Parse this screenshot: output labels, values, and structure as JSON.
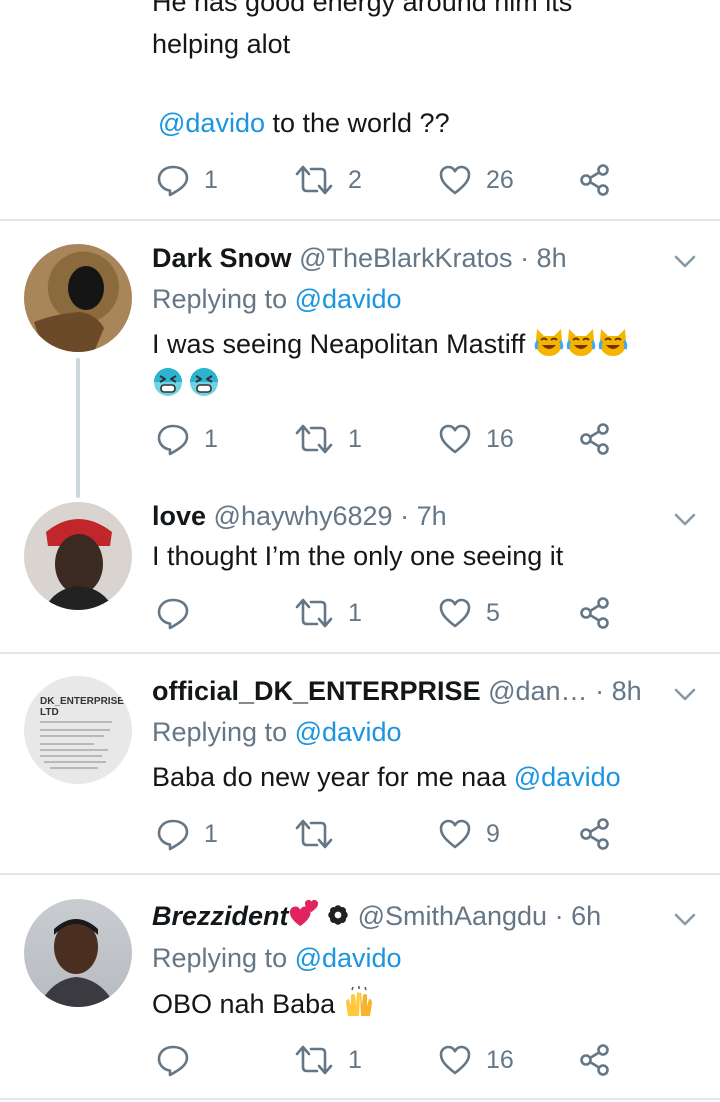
{
  "top_tweet": {
    "cut_line": "He has good energy around him its",
    "line2": "helping alot",
    "mention": "@davido",
    "line3_rest": " to the world ??",
    "replies": "1",
    "retweets": "2",
    "likes": "26"
  },
  "tweets": [
    {
      "name": "Dark Snow",
      "handle": "@TheBlarkKratos",
      "time": "· 8h",
      "replying_prefix": "Replying to ",
      "replying_to": "@davido",
      "text": "I was seeing Neapolitan Mastiff",
      "emoji_row1": [
        "cat-tears-of-joy-emoji",
        "cat-tears-of-joy-emoji",
        "cat-tears-of-joy-emoji"
      ],
      "emoji_row2": [
        "tired-face-emoji",
        "tired-face-emoji"
      ],
      "replies": "1",
      "retweets": "1",
      "likes": "16"
    },
    {
      "name": "love",
      "handle": "@haywhy6829",
      "time": "· 7h",
      "text": "I thought I’m the only one seeing it",
      "replies": "",
      "retweets": "1",
      "likes": "5"
    },
    {
      "name": "official_DK_ENTERPRISE",
      "handle": "@dan…",
      "time": "· 8h",
      "replying_prefix": "Replying to ",
      "replying_to": "@davido",
      "text": "Baba do new year for me naa ",
      "text_mention": "@davido",
      "avatar_title": "DK_ENTERPRISE LTD",
      "replies": "1",
      "retweets": "",
      "likes": "9"
    },
    {
      "name": "Brezzident",
      "handle": "@SmithAangdu",
      "time": "· 6h",
      "replying_prefix": "Replying to ",
      "replying_to": "@davido",
      "text": "OBO nah Baba",
      "replies": "",
      "retweets": "1",
      "likes": "16"
    }
  ],
  "icons": {
    "reply": "reply-icon",
    "retweet": "retweet-icon",
    "like": "heart-icon",
    "share": "share-icon",
    "caret": "chevron-down-icon"
  },
  "colors": {
    "text": "#14171a",
    "secondary": "#657786",
    "link": "#1b95e0",
    "separator": "#e1e8ed"
  }
}
